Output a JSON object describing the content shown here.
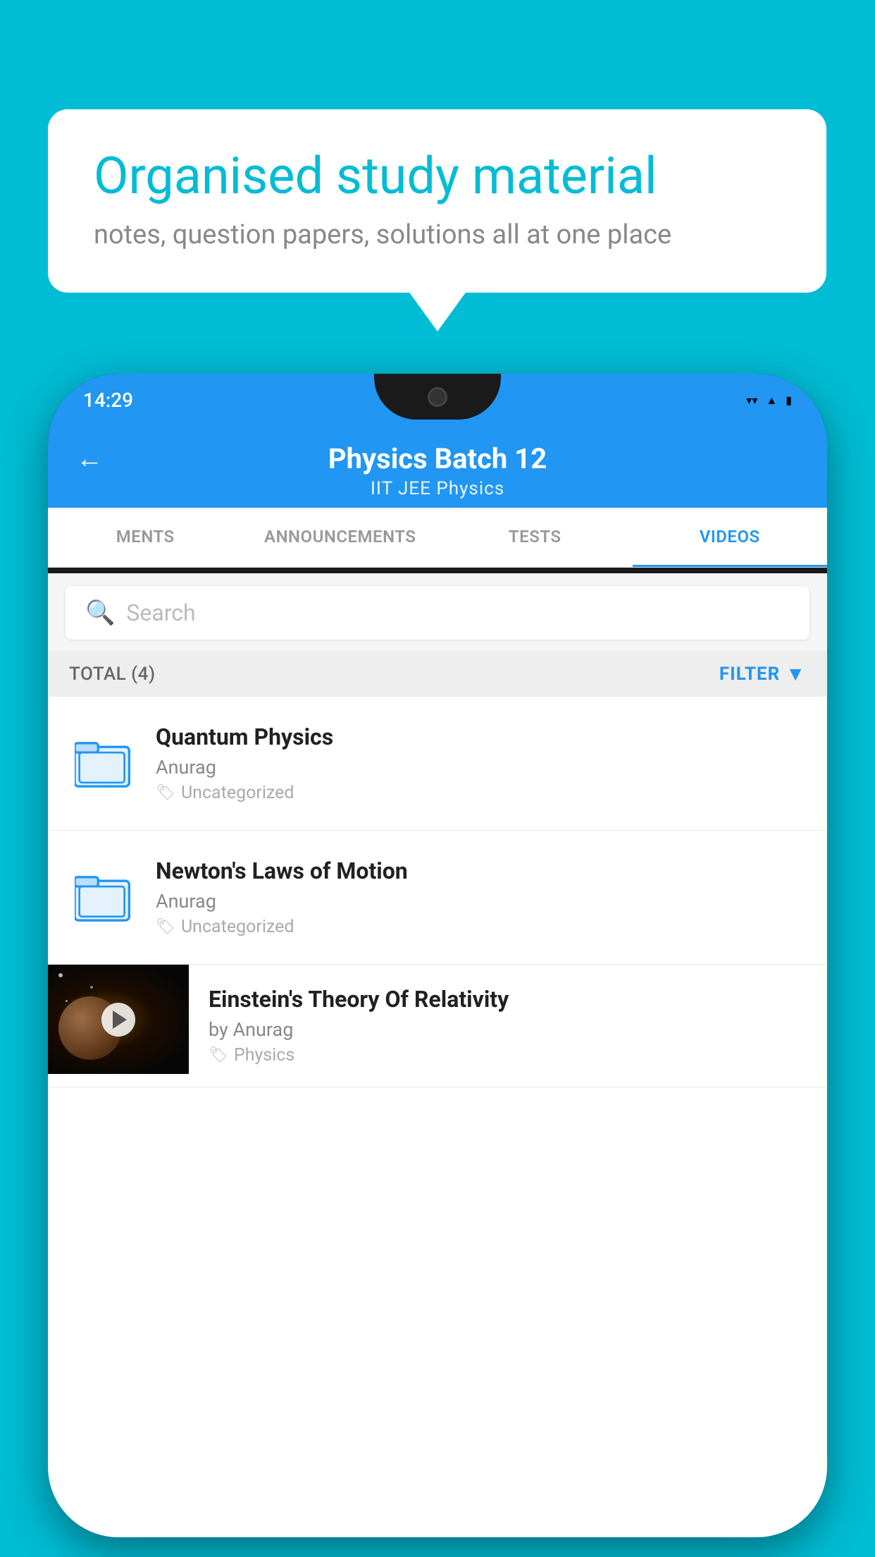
{
  "background": {
    "color": "#00bcd4"
  },
  "bubble": {
    "title": "Organised study material",
    "subtitle": "notes, question papers, solutions all at one place"
  },
  "phone": {
    "status": {
      "time": "14:29"
    },
    "header": {
      "back_label": "←",
      "title": "Physics Batch 12",
      "subtitle": "IIT JEE   Physics"
    },
    "tabs": [
      {
        "label": "MENTS",
        "active": false
      },
      {
        "label": "ANNOUNCEMENTS",
        "active": false
      },
      {
        "label": "TESTS",
        "active": false
      },
      {
        "label": "VIDEOS",
        "active": true
      }
    ],
    "search": {
      "placeholder": "Search"
    },
    "filter": {
      "total_label": "TOTAL (4)",
      "filter_label": "FILTER"
    },
    "videos": [
      {
        "title": "Quantum Physics",
        "author": "Anurag",
        "tag": "Uncategorized",
        "type": "folder",
        "has_thumbnail": false
      },
      {
        "title": "Newton's Laws of Motion",
        "author": "Anurag",
        "tag": "Uncategorized",
        "type": "folder",
        "has_thumbnail": false
      },
      {
        "title": "Einstein's Theory Of Relativity",
        "author": "by Anurag",
        "tag": "Physics",
        "type": "video",
        "has_thumbnail": true
      }
    ]
  }
}
